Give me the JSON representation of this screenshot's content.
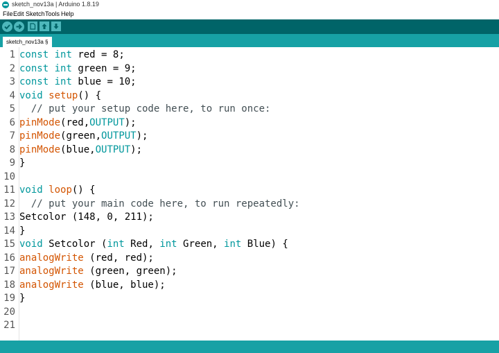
{
  "window": {
    "title": "sketch_nov13a | Arduino 1.8.19"
  },
  "menu": {
    "items": [
      "File",
      "Edit",
      "Sketch",
      "Tools",
      "Help"
    ]
  },
  "toolbar": {
    "icons": [
      "verify-icon",
      "upload-icon",
      "new-icon",
      "open-icon",
      "save-icon"
    ]
  },
  "tabs": {
    "active": "sketch_nov13a §"
  },
  "editor": {
    "line_numbers": [
      "1",
      "2",
      "3",
      "4",
      "5",
      "6",
      "7",
      "8",
      "9",
      "10",
      "11",
      "12",
      "13",
      "14",
      "15",
      "16",
      "17",
      "18",
      "19",
      "20",
      "21"
    ],
    "lines": [
      [
        {
          "t": "const",
          "k": "kw"
        },
        {
          "t": " "
        },
        {
          "t": "int",
          "k": "kw"
        },
        {
          "t": " red = 8;"
        }
      ],
      [
        {
          "t": "const",
          "k": "kw"
        },
        {
          "t": " "
        },
        {
          "t": "int",
          "k": "kw"
        },
        {
          "t": " green = 9;"
        }
      ],
      [
        {
          "t": "const",
          "k": "kw"
        },
        {
          "t": " "
        },
        {
          "t": "int",
          "k": "kw"
        },
        {
          "t": " blue = 10;"
        }
      ],
      [
        {
          "t": "void",
          "k": "kw"
        },
        {
          "t": " "
        },
        {
          "t": "setup",
          "k": "fn"
        },
        {
          "t": "() {"
        }
      ],
      [
        {
          "t": "  // put your setup code here, to run once:",
          "k": "cm"
        }
      ],
      [
        {
          "t": "pinMode",
          "k": "fn"
        },
        {
          "t": "(red,"
        },
        {
          "t": "OUTPUT",
          "k": "ct"
        },
        {
          "t": ");"
        }
      ],
      [
        {
          "t": "pinMode",
          "k": "fn"
        },
        {
          "t": "(green,"
        },
        {
          "t": "OUTPUT",
          "k": "ct"
        },
        {
          "t": ");"
        }
      ],
      [
        {
          "t": "pinMode",
          "k": "fn"
        },
        {
          "t": "(blue,"
        },
        {
          "t": "OUTPUT",
          "k": "ct"
        },
        {
          "t": ");"
        }
      ],
      [
        {
          "t": "}"
        }
      ],
      [],
      [
        {
          "t": "void",
          "k": "kw"
        },
        {
          "t": " "
        },
        {
          "t": "loop",
          "k": "fn"
        },
        {
          "t": "() {"
        }
      ],
      [
        {
          "t": "  // put your main code here, to run repeatedly:",
          "k": "cm"
        }
      ],
      [
        {
          "t": "Setcolor (148, 0, 211);"
        }
      ],
      [
        {
          "t": "}"
        }
      ],
      [
        {
          "t": "void",
          "k": "kw"
        },
        {
          "t": " Setcolor ("
        },
        {
          "t": "int",
          "k": "kw"
        },
        {
          "t": " Red, "
        },
        {
          "t": "int",
          "k": "kw"
        },
        {
          "t": " Green, "
        },
        {
          "t": "int",
          "k": "kw"
        },
        {
          "t": " Blue) {"
        }
      ],
      [
        {
          "t": "analogWrite",
          "k": "fn"
        },
        {
          "t": " (red, red);"
        }
      ],
      [
        {
          "t": "analogWrite",
          "k": "fn"
        },
        {
          "t": " (green, green);"
        }
      ],
      [
        {
          "t": "analogWrite",
          "k": "fn"
        },
        {
          "t": " (blue, blue);"
        }
      ],
      [
        {
          "t": "}"
        }
      ],
      [],
      []
    ]
  },
  "colors": {
    "toolbar": "#006468",
    "tabbar": "#17a1a5",
    "button": "#4db7bb",
    "keyword": "#00979c",
    "function": "#d35400"
  }
}
